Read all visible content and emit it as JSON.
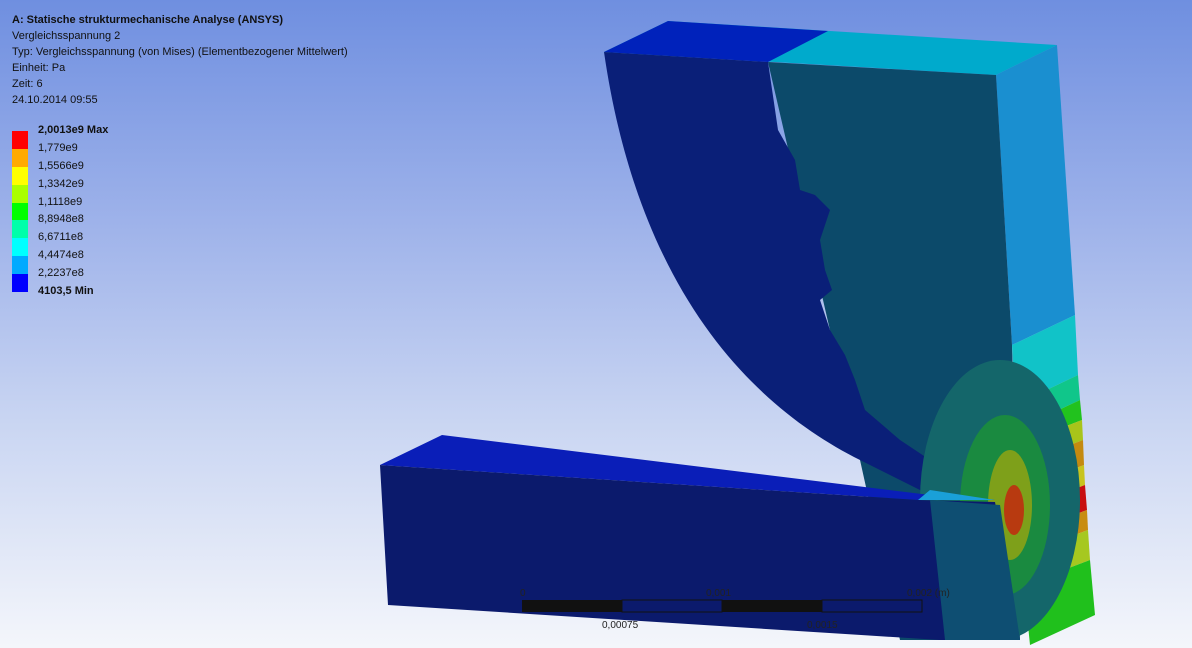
{
  "header": {
    "title": "A: Statische strukturmechanische Analyse (ANSYS)",
    "result_name": "Vergleichsspannung 2",
    "type": "Typ: Vergleichsspannung (von Mises) (Elementbezogener Mittelwert)",
    "unit": "Einheit: Pa",
    "time": "Zeit: 6",
    "date": "24.10.2014 09:55"
  },
  "legend": {
    "items": [
      {
        "label": "2,0013e9 Max",
        "color": "#ff0000",
        "bold": true
      },
      {
        "label": "1,779e9",
        "color": "#ffaa00",
        "bold": false
      },
      {
        "label": "1,5566e9",
        "color": "#ffff00",
        "bold": false
      },
      {
        "label": "1,3342e9",
        "color": "#aaff00",
        "bold": false
      },
      {
        "label": "1,1118e9",
        "color": "#00ff00",
        "bold": false
      },
      {
        "label": "8,8948e8",
        "color": "#00ffaa",
        "bold": false
      },
      {
        "label": "6,6711e8",
        "color": "#00ffff",
        "bold": false
      },
      {
        "label": "4,4474e8",
        "color": "#00aaff",
        "bold": false
      },
      {
        "label": "2,2237e8",
        "color": "#0000ff",
        "bold": false
      },
      {
        "label": "4103,5 Min",
        "color": "#0000ff",
        "bold": true
      }
    ]
  },
  "scale": {
    "label_0": "0",
    "label_mid": "0,001",
    "label_end": "0,002 (m)",
    "label_q1": "0,00075",
    "label_q3": "0,0015"
  }
}
